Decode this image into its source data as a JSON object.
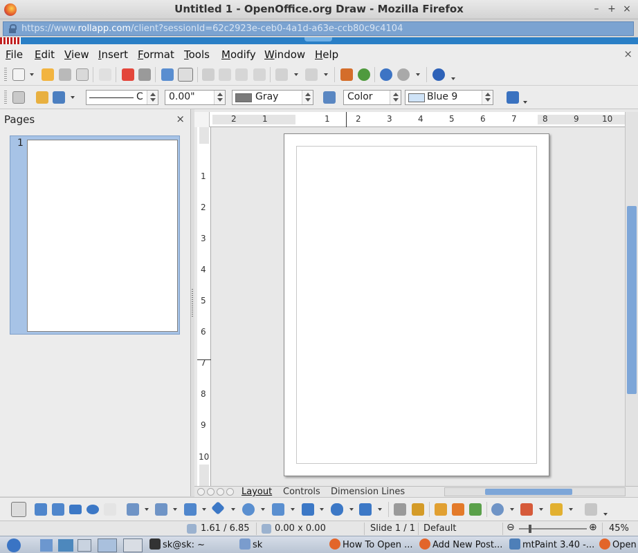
{
  "window": {
    "title": "Untitled 1 - OpenOffice.org Draw - Mozilla Firefox",
    "min_glyph": "–",
    "max_glyph": "+",
    "close_glyph": "×"
  },
  "browser": {
    "url_prefix": "https://www.",
    "url_host": "rollapp.com",
    "url_path": "/client?sessionId=62c2923e-ceb0-4a1d-a63e-ccb80c9c4104"
  },
  "menu": {
    "items": [
      {
        "label": "File",
        "u": "F",
        "rest": "ile"
      },
      {
        "label": "Edit",
        "u": "E",
        "rest": "dit"
      },
      {
        "label": "View",
        "u": "V",
        "rest": "iew"
      },
      {
        "label": "Insert",
        "u": "I",
        "rest": "nsert"
      },
      {
        "label": "Format",
        "u": "F",
        "rest": "ormat"
      },
      {
        "label": "Tools",
        "u": "T",
        "rest": "ools"
      },
      {
        "label": "Modify",
        "u": "M",
        "rest": "odify"
      },
      {
        "label": "Window",
        "u": "W",
        "rest": "indow"
      },
      {
        "label": "Help",
        "u": "H",
        "rest": "elp"
      }
    ],
    "close_glyph": "×"
  },
  "line_toolbar": {
    "line_style_value": "C",
    "line_width_value": "0.00\"",
    "line_color_value": "Gray",
    "line_color_hex": "#7a7a7a",
    "area_style_value": "Color",
    "area_fill_value": "Blue 9",
    "area_fill_hex": "#cfe3f7"
  },
  "pages_panel": {
    "title": "Pages",
    "close_glyph": "×",
    "page_number": "1"
  },
  "ruler": {
    "h_ticks": [
      "2",
      "1",
      "1",
      "2",
      "3",
      "4",
      "5",
      "6",
      "7",
      "8",
      "9",
      "10"
    ],
    "v_ticks": [
      "1",
      "2",
      "3",
      "4",
      "5",
      "6",
      "7",
      "8",
      "9",
      "10"
    ]
  },
  "layer_tabs": [
    {
      "label": "Layout",
      "active": true
    },
    {
      "label": "Controls",
      "active": false
    },
    {
      "label": "Dimension Lines",
      "active": false
    }
  ],
  "status": {
    "position": "1.61 / 6.85",
    "size": "0.00 x 0.00",
    "slide": "Slide 1 / 1",
    "master": "Default",
    "zoom": "45%",
    "zoom_minus": "⊖",
    "zoom_plus": "⊕"
  },
  "taskbar": {
    "items": [
      {
        "label": "sk@sk: ~"
      },
      {
        "label": "sk"
      },
      {
        "label": "How To Open ..."
      },
      {
        "label": "Add New Post..."
      },
      {
        "label": "mtPaint 3.40 -..."
      },
      {
        "label": "Open"
      }
    ]
  },
  "colors": {
    "selection_blue": "#a7c3e6",
    "scroll_thumb": "#7da6d8",
    "rollapp_blue": "#2a7fc6"
  }
}
